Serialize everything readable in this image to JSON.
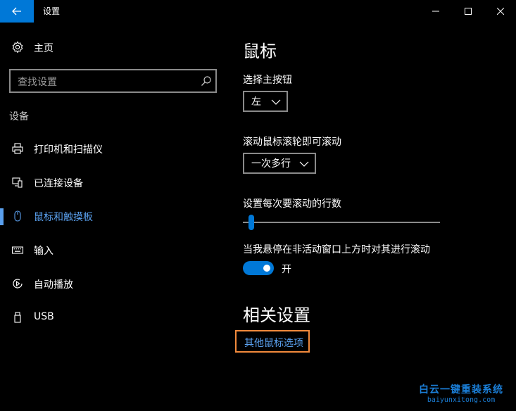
{
  "window": {
    "title": "设置"
  },
  "sidebar": {
    "home_label": "主页",
    "search_placeholder": "查找设置",
    "section_label": "设备",
    "items": [
      {
        "label": "打印机和扫描仪",
        "icon": "printer-icon"
      },
      {
        "label": "已连接设备",
        "icon": "connected-devices-icon"
      },
      {
        "label": "鼠标和触摸板",
        "icon": "mouse-icon",
        "active": true
      },
      {
        "label": "输入",
        "icon": "keyboard-icon"
      },
      {
        "label": "自动播放",
        "icon": "autoplay-icon"
      },
      {
        "label": "USB",
        "icon": "usb-icon"
      }
    ]
  },
  "main": {
    "title": "鼠标",
    "primary_button": {
      "label": "选择主按钮",
      "value": "左"
    },
    "wheel_scroll": {
      "label": "滚动鼠标滚轮即可滚动",
      "value": "一次多行"
    },
    "lines_to_scroll": {
      "label": "设置每次要滚动的行数",
      "level_fraction": 0.03
    },
    "inactive_scroll": {
      "label": "当我悬停在非活动窗口上方时对其进行滚动",
      "toggle_state": "开"
    },
    "related": {
      "title": "相关设置",
      "link": "其他鼠标选项"
    }
  },
  "watermark": {
    "main": "白云一键重装系统",
    "sub": "baiyunxitong.com"
  },
  "colors": {
    "accent": "#0078d7",
    "link": "#5aa0ee",
    "highlight_border": "#f28a3c",
    "background": "#000000"
  }
}
